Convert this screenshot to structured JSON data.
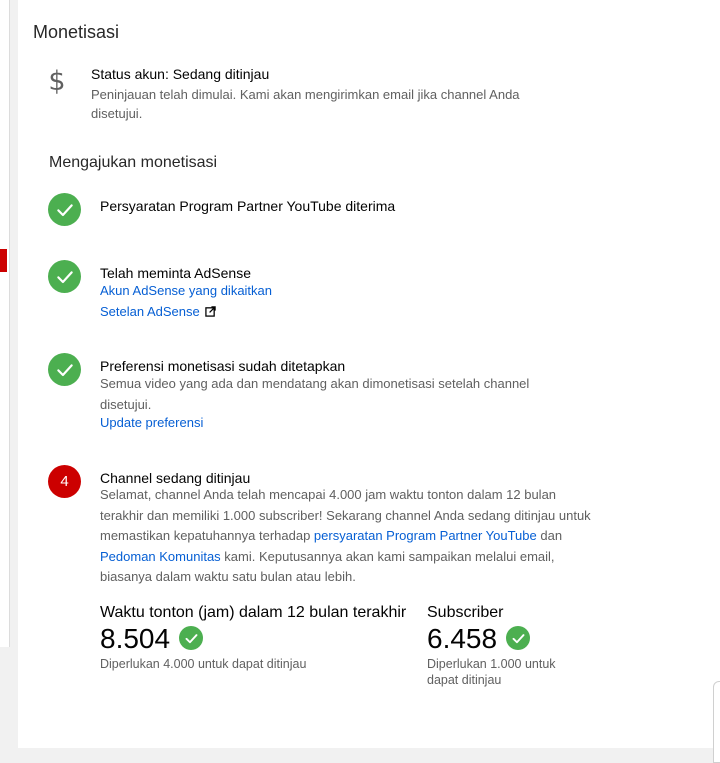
{
  "monetization": {
    "title": "Monetisasi",
    "status": {
      "icon": "dollar-icon",
      "title": "Status akun: Sedang ditinjau",
      "description": "Peninjauan telah dimulai. Kami akan mengirimkan email jika channel Anda disetujui."
    },
    "apply_title": "Mengajukan monetisasi",
    "steps": [
      {
        "state": "done",
        "title": "Persyaratan Program Partner YouTube diterima"
      },
      {
        "state": "done",
        "title": "Telah meminta AdSense",
        "link1": "Akun AdSense yang dikaitkan",
        "link2": "Setelan AdSense"
      },
      {
        "state": "done",
        "title": "Preferensi monetisasi sudah ditetapkan",
        "description": "Semua video yang ada dan mendatang akan dimonetisasi setelah channel disetujui.",
        "link": "Update preferensi"
      },
      {
        "state": "in-review",
        "number": "4",
        "title": "Channel sedang ditinjau",
        "desc_part1": "Selamat, channel Anda telah mencapai 4.000 jam waktu tonton dalam 12 bulan terakhir dan memiliki 1.000 subscriber! Sekarang channel Anda sedang ditinjau untuk memastikan kepatuhannya terhadap ",
        "desc_link1": "persyaratan Program Partner YouTube",
        "desc_part2": " dan ",
        "desc_link2": "Pedoman Komunitas",
        "desc_part3": " kami. Keputusannya akan kami sampaikan melalui email, biasanya dalam waktu satu bulan atau lebih."
      }
    ],
    "metrics": [
      {
        "label": "Waktu tonton (jam) dalam 12 bulan terakhir",
        "value": "8.504",
        "note": "Diperlukan 4.000 untuk dapat ditinjau"
      },
      {
        "label": "Subscriber",
        "value": "6.458",
        "note": "Diperlukan 1.000 untuk dapat ditinjau"
      }
    ]
  },
  "colors": {
    "accent_red": "#cc0000",
    "check_green": "#4caf50",
    "link_blue": "#065fd4"
  }
}
